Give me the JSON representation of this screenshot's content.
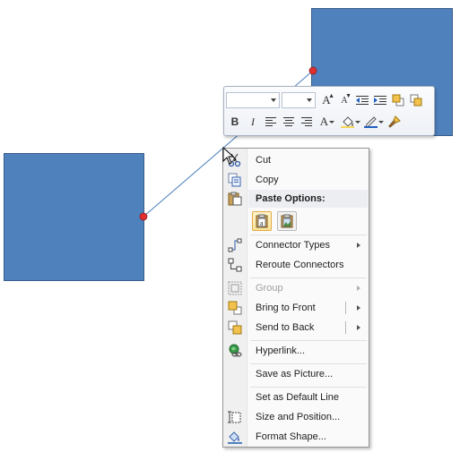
{
  "menu": {
    "cut": "Cut",
    "copy": "Copy",
    "paste_options": "Paste Options:",
    "connector_types": "Connector Types",
    "reroute_connectors": "Reroute Connectors",
    "group": "Group",
    "bring_to_front": "Bring to Front",
    "send_to_back": "Send to Back",
    "hyperlink": "Hyperlink...",
    "save_as_picture": "Save as Picture...",
    "set_as_default_line": "Set as Default Line",
    "size_and_position": "Size and Position...",
    "format_shape": "Format Shape..."
  },
  "toolbar": {
    "font_name": "",
    "font_size": "",
    "grow_font": "A",
    "shrink_font": "A",
    "bold": "B",
    "italic": "I",
    "font_color": "A"
  },
  "colors": {
    "shape_fill": "#4f81bd",
    "shape_border": "#385d8a",
    "connector": "#4a7ebb",
    "endpoint": "#e03030",
    "highlight": "#fde39a"
  }
}
